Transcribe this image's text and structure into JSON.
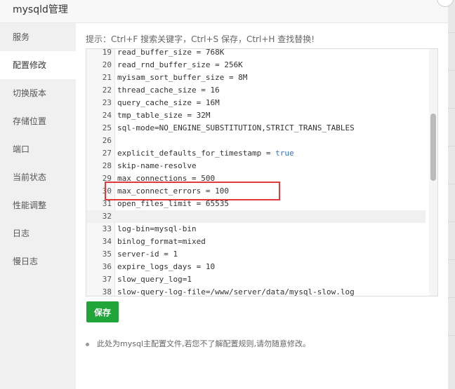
{
  "window": {
    "title": "mysqld管理"
  },
  "sidebar": {
    "items": [
      {
        "label": "服务"
      },
      {
        "label": "配置修改"
      },
      {
        "label": "切换版本"
      },
      {
        "label": "存储位置"
      },
      {
        "label": "端口"
      },
      {
        "label": "当前状态"
      },
      {
        "label": "性能调整"
      },
      {
        "label": "日志"
      },
      {
        "label": "慢日志"
      }
    ],
    "active_index": 1
  },
  "main": {
    "tip": "提示：Ctrl+F 搜索关键字，Ctrl+S 保存，Ctrl+H 查找替换!",
    "save_label": "保存",
    "note": "此处为mysql主配置文件,若您不了解配置规则,请勿随意修改。"
  },
  "editor": {
    "lines": [
      {
        "num": "19",
        "text": "read_buffer_size = 768K"
      },
      {
        "num": "20",
        "text": "read_rnd_buffer_size = 256K"
      },
      {
        "num": "21",
        "text": "myisam_sort_buffer_size = 8M"
      },
      {
        "num": "22",
        "text": "thread_cache_size = 16"
      },
      {
        "num": "23",
        "text": "query_cache_size = 16M"
      },
      {
        "num": "24",
        "text": "tmp_table_size = 32M"
      },
      {
        "num": "25",
        "text": "sql-mode=NO_ENGINE_SUBSTITUTION,STRICT_TRANS_TABLES"
      },
      {
        "num": "26",
        "text": ""
      },
      {
        "num": "27",
        "text": "explicit_defaults_for_timestamp = ",
        "keyword": "true"
      },
      {
        "num": "28",
        "text": "skip-name-resolve"
      },
      {
        "num": "29",
        "text": "max_connections = 500"
      },
      {
        "num": "30",
        "text": "max_connect_errors = 100"
      },
      {
        "num": "31",
        "text": "open_files_limit = 65535"
      },
      {
        "num": "32",
        "text": ""
      },
      {
        "num": "33",
        "text": "log-bin=mysql-bin"
      },
      {
        "num": "34",
        "text": "binlog_format=mixed"
      },
      {
        "num": "35",
        "text": "server-id = 1"
      },
      {
        "num": "36",
        "text": "expire_logs_days = 10"
      },
      {
        "num": "37",
        "text": "slow_query_log=1"
      },
      {
        "num": "38",
        "text": "slow-query-log-file=/www/server/data/mysql-slow.log"
      }
    ],
    "current_line": "32",
    "highlighted_line": "28"
  },
  "colors": {
    "accent_green": "#20a53a",
    "highlight_red": "#e0393e",
    "keyword_blue": "#3070c0"
  }
}
